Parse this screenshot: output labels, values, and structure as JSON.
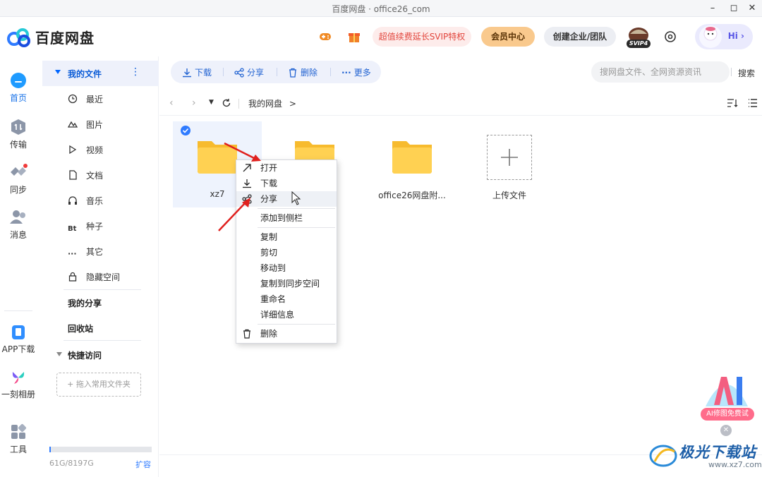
{
  "window": {
    "title": "百度网盘 · office26_com"
  },
  "header": {
    "brand": "百度网盘",
    "promo": "超值续费延长SVIP特权",
    "vip_center": "会员中心",
    "create_team": "创建企业/团队",
    "svip_badge": "SVIP4",
    "greeting": "Hi",
    "accent": "#2f7bff"
  },
  "rail": {
    "home": "首页",
    "transfer": "传输",
    "sync": "同步",
    "messages": "消息",
    "app_download": "APP下载",
    "album": "一刻相册",
    "tools": "工具"
  },
  "sidebar": {
    "my_files": "我的文件",
    "items": [
      {
        "label": "最近",
        "icon": "clock-icon"
      },
      {
        "label": "图片",
        "icon": "image-icon"
      },
      {
        "label": "视频",
        "icon": "play-icon"
      },
      {
        "label": "文档",
        "icon": "document-icon"
      },
      {
        "label": "音乐",
        "icon": "headphones-icon"
      },
      {
        "label": "种子",
        "icon": "bt-icon"
      },
      {
        "label": "其它",
        "icon": "more-icon"
      },
      {
        "label": "隐藏空间",
        "icon": "lock-icon"
      }
    ],
    "my_share": "我的分享",
    "recycle": "回收站",
    "quick_access": "快捷访问",
    "drag_hint": "+ 拖入常用文件夹",
    "quota_text": "61G/8197G",
    "quota_used_fraction": 0.0074,
    "expand": "扩容"
  },
  "toolbar": {
    "download": "下载",
    "share": "分享",
    "delete": "删除",
    "more": "更多",
    "search_placeholder": "搜网盘文件、全网资源资讯",
    "search_button": "搜索"
  },
  "nav": {
    "crumb": "我的网盘",
    "crumb_sep": ">"
  },
  "files": [
    {
      "name": "xz7",
      "selected": true
    },
    {
      "name": "",
      "selected": false
    },
    {
      "name": "office26网盘附...",
      "selected": false
    }
  ],
  "upload_label": "上传文件",
  "context_menu": {
    "open": "打开",
    "download": "下载",
    "share": "分享",
    "add_sidebar": "添加到侧栏",
    "copy": "复制",
    "cut": "剪切",
    "move_to": "移动到",
    "copy_to_sync": "复制到同步空间",
    "rename": "重命名",
    "details": "详细信息",
    "delete": "删除"
  },
  "ai_promo": {
    "label": "AI修图免费试"
  },
  "watermark": {
    "text": "极光下载站",
    "sub": "www.xz7.com"
  }
}
